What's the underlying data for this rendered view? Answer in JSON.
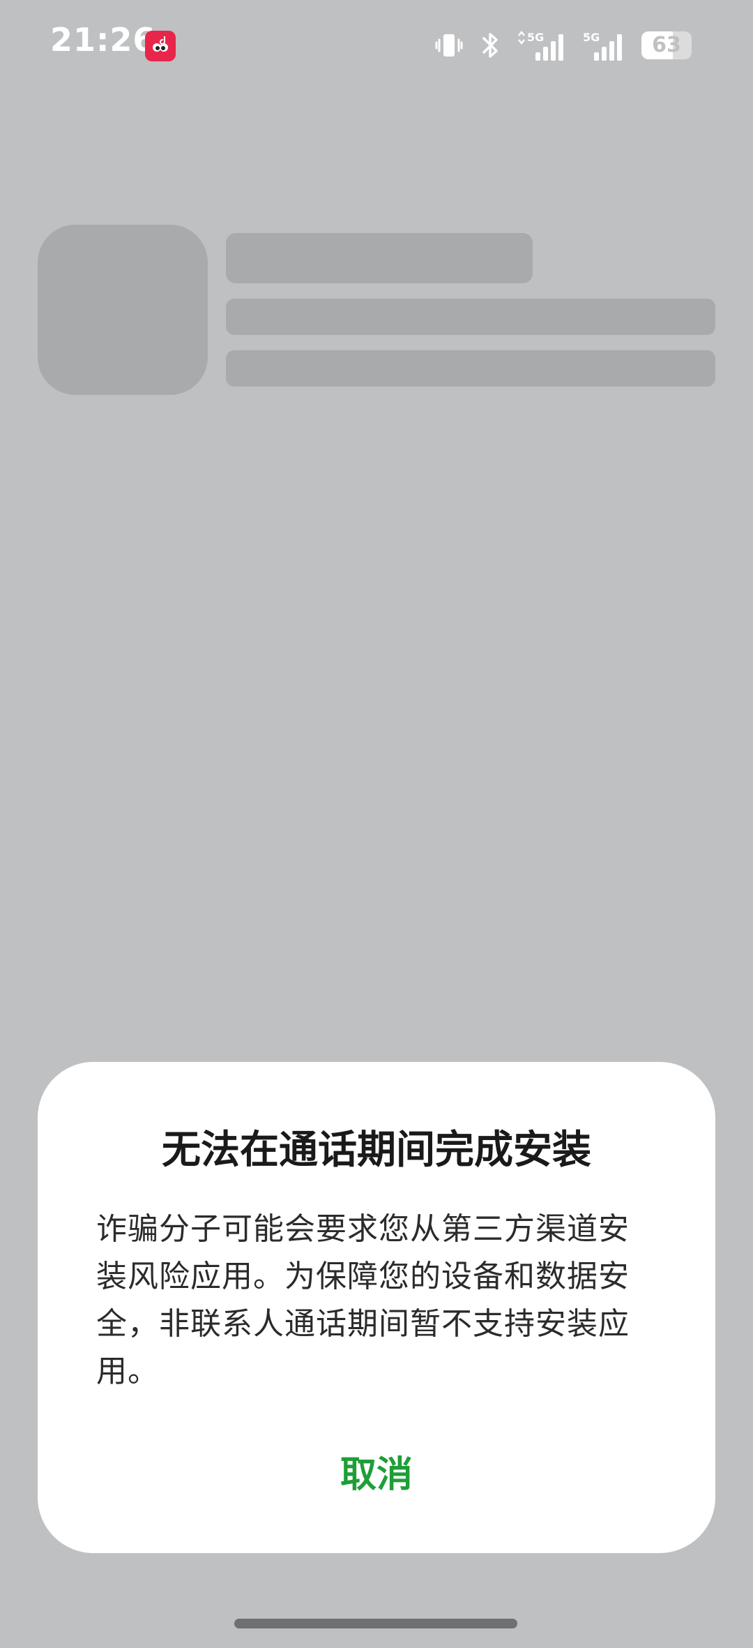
{
  "status_bar": {
    "time": "21:26",
    "app_badge_icon": "red-cartoon-app-icon",
    "icons": [
      "vibrate-icon",
      "bluetooth-icon",
      "signal-5g-icon",
      "signal-5g-icon"
    ],
    "network_1": "5G",
    "network_2": "5G",
    "battery_level": "63",
    "battery_fraction": 0.63
  },
  "dialog": {
    "title": "无法在通话期间完成安装",
    "message": "诈骗分子可能会要求您从第三方渠道安装风险应用。为保障您的设备和数据安全，非联系人通话期间暂不支持安装应用。",
    "cancel_label": "取消"
  },
  "colors": {
    "accent": "#1f9e38",
    "scrim": "#bfc0c2",
    "skeleton": "#a9aaab"
  }
}
